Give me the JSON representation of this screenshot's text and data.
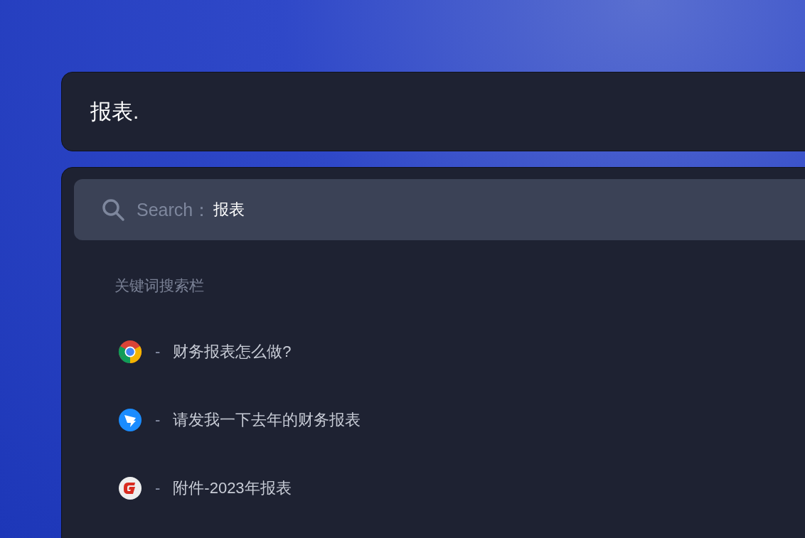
{
  "query_bar": {
    "text": "报表."
  },
  "search": {
    "label": "Search：",
    "value": "报表"
  },
  "section_title": "关键词搜索栏",
  "results": [
    {
      "kind": "browser",
      "separator": "-",
      "text": "财务报表怎么做?"
    },
    {
      "kind": "messenger",
      "separator": "-",
      "text": "请发我一下去年的财务报表"
    },
    {
      "kind": "document",
      "separator": "-",
      "text": "附件-2023年报表"
    }
  ]
}
